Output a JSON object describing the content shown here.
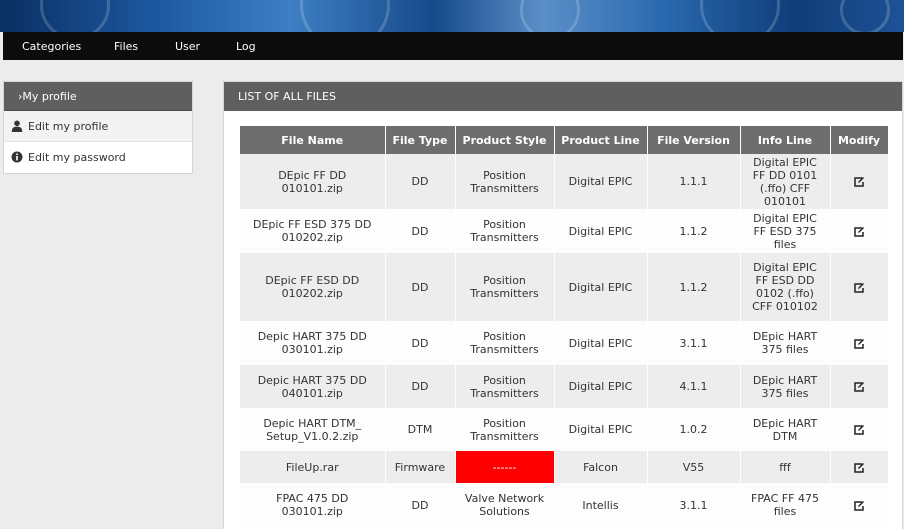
{
  "nav": {
    "items": [
      {
        "label": "Categories"
      },
      {
        "label": "Files"
      },
      {
        "label": "User"
      },
      {
        "label": "Log"
      }
    ]
  },
  "sidebar": {
    "header": "›My profile",
    "items": [
      {
        "label": "Edit my profile",
        "icon": "user-icon"
      },
      {
        "label": "Edit my password",
        "icon": "info-icon"
      }
    ]
  },
  "panel": {
    "title": "LIST OF ALL FILES"
  },
  "table": {
    "columns": [
      "File Name",
      "File Type",
      "Product Style",
      "Product Line",
      "File Version",
      "Info Line",
      "Modify"
    ],
    "rows": [
      {
        "file_name": "DEpic FF DD 010101.zip",
        "file_type": "DD",
        "product_style": "Position Transmitters",
        "product_line": "Digital EPIC",
        "file_version": "1.1.1",
        "info_line": "Digital EPIC FF DD 0101 (.ffo) CFF 010101"
      },
      {
        "file_name": "DEpic FF ESD 375 DD 010202.zip",
        "file_type": "DD",
        "product_style": "Position Transmitters",
        "product_line": "Digital EPIC",
        "file_version": "1.1.2",
        "info_line": "Digital EPIC FF ESD 375 files"
      },
      {
        "file_name": "DEpic FF ESD DD 010202.zip",
        "file_type": "DD",
        "product_style": "Position Transmitters",
        "product_line": "Digital EPIC",
        "file_version": "1.1.2",
        "info_line": "Digital EPIC FF ESD DD 0102 (.ffo) CFF 010102"
      },
      {
        "file_name": "Depic HART 375 DD 030101.zip",
        "file_type": "DD",
        "product_style": "Position Transmitters",
        "product_line": "Digital EPIC",
        "file_version": "3.1.1",
        "info_line": "DEpic HART 375 files"
      },
      {
        "file_name": "Depic HART 375 DD 040101.zip",
        "file_type": "DD",
        "product_style": "Position Transmitters",
        "product_line": "Digital EPIC",
        "file_version": "4.1.1",
        "info_line": "DEpic HART 375 files"
      },
      {
        "file_name": "Depic HART DTM_ Setup_V1.0.2.zip",
        "file_type": "DTM",
        "product_style": "Position Transmitters",
        "product_line": "Digital EPIC",
        "file_version": "1.0.2",
        "info_line": "DEpic HART DTM"
      },
      {
        "file_name": "FileUp.rar",
        "file_type": "Firmware",
        "product_style": "------",
        "product_line": "Falcon",
        "file_version": "V55",
        "info_line": "fff",
        "highlight_color": "#ff0000"
      },
      {
        "file_name": "FPAC 475 DD 030101.zip",
        "file_type": "DD",
        "product_style": "Valve Network Solutions",
        "product_line": "Intellis",
        "file_version": "3.1.1",
        "info_line": "FPAC FF 475 files"
      }
    ]
  }
}
